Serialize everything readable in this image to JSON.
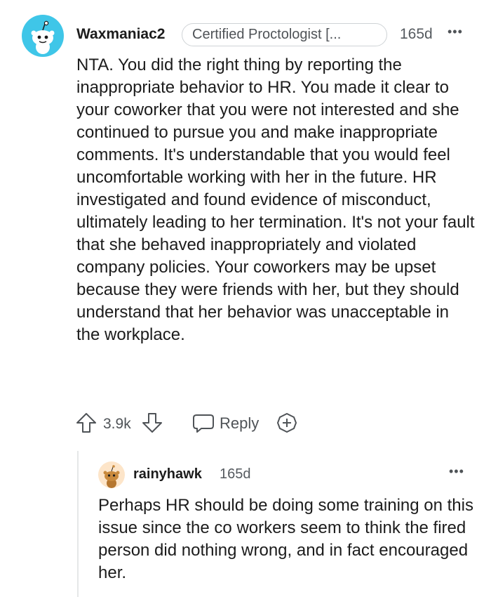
{
  "parent_comment": {
    "username": "Waxmaniac2",
    "flair": "Certified Proctologist [...",
    "age": "165d",
    "more_icon": "•••",
    "body": "NTA. You did the right thing by reporting the inappropriate behavior to HR. You made it clear to your coworker that you were not interested and she continued to pursue you and make inappropriate comments. It's understandable that you would feel uncomfortable working with her in the future. HR investigated and found evidence of misconduct, ultimately leading to her termination. It's not your fault that she behaved inappropriately and violated company policies. Your coworkers may be upset because they were friends with her, but they should understand that her behavior was unacceptable in the workplace.",
    "votes": "3.9k",
    "reply_label": "Reply",
    "avatar_color": "#3fc6e8",
    "icons": [
      "upvote-icon",
      "downvote-icon",
      "reply-bubble-icon",
      "award-plus-icon",
      "more-icon"
    ]
  },
  "reply_comment": {
    "username": "rainyhawk",
    "age": "165d",
    "more_icon": "•••",
    "body": "Perhaps HR should be doing some training on this issue since the co workers seem to think the fired person did nothing wrong, and in fact encouraged her.",
    "avatar_color": "#fde5c9"
  },
  "colors": {
    "text": "#1c1c1c",
    "meta": "#555a5f",
    "icon": "#4f5357",
    "thread_line": "#e5e7e8"
  }
}
